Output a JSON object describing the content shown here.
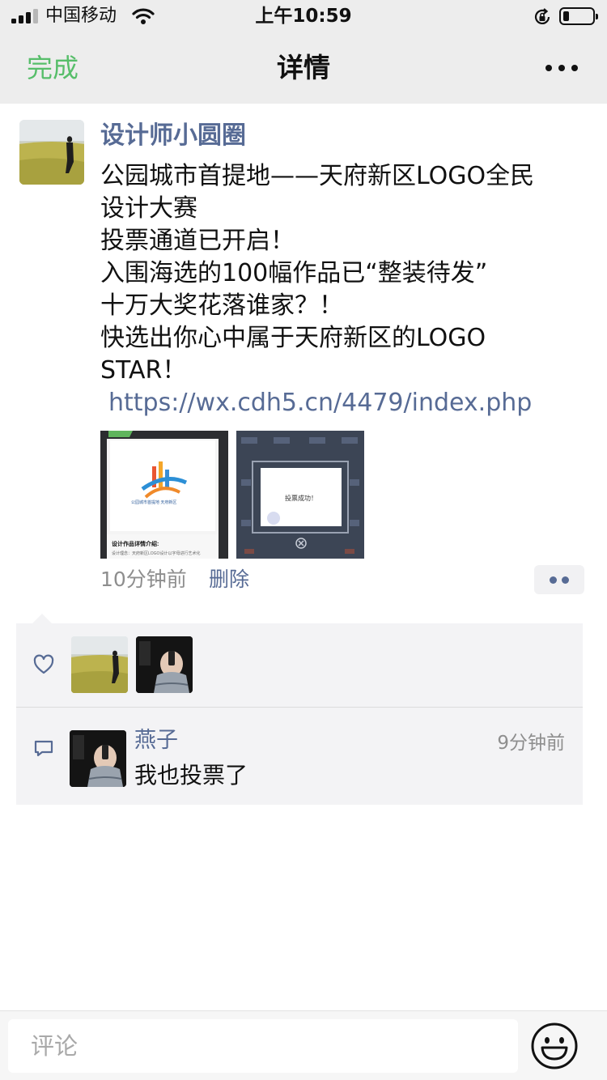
{
  "status_bar": {
    "carrier": "中国移动",
    "time": "上午10:59"
  },
  "nav": {
    "done_label": "完成",
    "title": "详情"
  },
  "post": {
    "author": "设计师小圆圈",
    "lines": [
      "公园城市首提地——天府新区LOGO全民",
      "设计大赛",
      "投票通道已开启！",
      "入围海选的100幅作品已“整装待发”",
      "十万大奖花落谁家？！",
      "快选出你心中属于天府新区的LOGO",
      "STAR！"
    ],
    "link": "https://wx.cdh5.cn/4479/index.php",
    "images": [
      {
        "caption": "公园城市首提地 天府新区",
        "details_heading": "设计作品详情介绍:",
        "details_text": "设计理念：天府新区LOGO设计以字母进行艺术化"
      },
      {
        "popup_text": "投票成功！"
      }
    ],
    "time": "10分钟前",
    "delete_label": "删除"
  },
  "comments": [
    {
      "name": "燕子",
      "time": "9分钟前",
      "text": "我也投票了"
    }
  ],
  "input": {
    "placeholder": "评论"
  },
  "colors": {
    "link_blue": "#576b95",
    "done_green": "#57be6a",
    "bar_gray": "#ededed"
  }
}
